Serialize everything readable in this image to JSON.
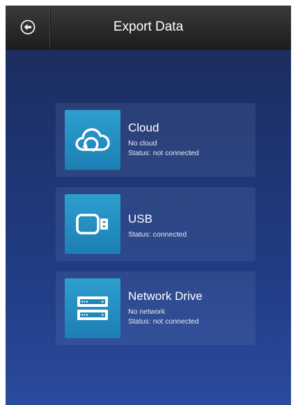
{
  "header": {
    "title": "Export Data",
    "back_icon": "back-arrow-circle-icon"
  },
  "options": [
    {
      "title": "Cloud",
      "lines": [
        "No cloud",
        "Status: not connected"
      ],
      "icon": "cloud-sync-icon"
    },
    {
      "title": "USB",
      "lines": [
        "Status: connected"
      ],
      "icon": "usb-drive-icon"
    },
    {
      "title": "Network Drive",
      "lines": [
        "No network",
        "Status: not connected"
      ],
      "icon": "network-drive-icon"
    }
  ],
  "colors": {
    "background_top": "#1b2a56",
    "background_bottom": "#2a4a9c",
    "tile": "#2490c4",
    "header": "#2a2a2a"
  }
}
